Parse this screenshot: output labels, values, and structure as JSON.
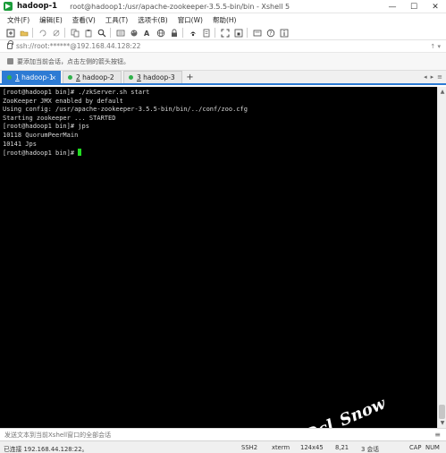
{
  "window": {
    "session_name": "hadoop-1",
    "title": "root@hadoop1:/usr/apache-zookeeper-3.5.5-bin/bin - Xshell 5",
    "controls": [
      "—",
      "☐",
      "✕"
    ]
  },
  "menu": [
    "文件(F)",
    "编辑(E)",
    "查看(V)",
    "工具(T)",
    "选项卡(B)",
    "窗口(W)",
    "帮助(H)"
  ],
  "toolbar": {
    "icons": [
      "new-session-icon",
      "open-folder-icon",
      "reconnect-icon",
      "disconnect-icon",
      "copy-icon",
      "paste-icon",
      "find-icon",
      "properties-icon",
      "color-scheme-icon",
      "font-icon",
      "globe-icon",
      "lock-icon",
      "transfer-icon",
      "script-icon",
      "fullscreen-icon",
      "lock-screen-icon",
      "compose-icon",
      "help-icon",
      "info-icon"
    ]
  },
  "address": {
    "text": "ssh://root:******@192.168.44.128:22",
    "right_glyphs": "↑ ▾"
  },
  "hint": {
    "text": "要添加当前会话，点击左侧的箭头按钮。"
  },
  "tabs": [
    {
      "num": "1",
      "label": "hadoop-1",
      "active": true
    },
    {
      "num": "2",
      "label": "hadoop-2",
      "active": false
    },
    {
      "num": "3",
      "label": "hadoop-3",
      "active": false
    }
  ],
  "tab_add": "+",
  "tab_nav": [
    "◂",
    "▸",
    "≡"
  ],
  "terminal": {
    "lines": [
      "[root@hadoop1 bin]# ./zkServer.sh start",
      "ZooKeeper JMX enabled by default",
      "Using config: /usr/apache-zookeeper-3.5.5-bin/bin/../conf/zoo.cfg",
      "Starting zookeeper ... STARTED",
      "[root@hadoop1 bin]# jps",
      "10118 QuorumPeerMain",
      "10141 Jps"
    ],
    "prompt": "[root@hadoop1 bin]# ",
    "cursor_color": "#22dd22",
    "watermark": "Dcl_Snow"
  },
  "input": {
    "placeholder": "发送文本到当前Xshell窗口的全部会话"
  },
  "status": {
    "connection": "已连接 192.168.44.128:22。",
    "protocol": "SSH2",
    "term": "xterm",
    "size": "124x45",
    "position": "8,21",
    "sessions": "3 会话",
    "caps": "CAP",
    "num": "NUM"
  },
  "colors": {
    "tab_active": "#2d7bd4",
    "terminal_bg": "#000000",
    "terminal_fg": "#d8d8d8",
    "connected_dot": "#2fb14a"
  }
}
